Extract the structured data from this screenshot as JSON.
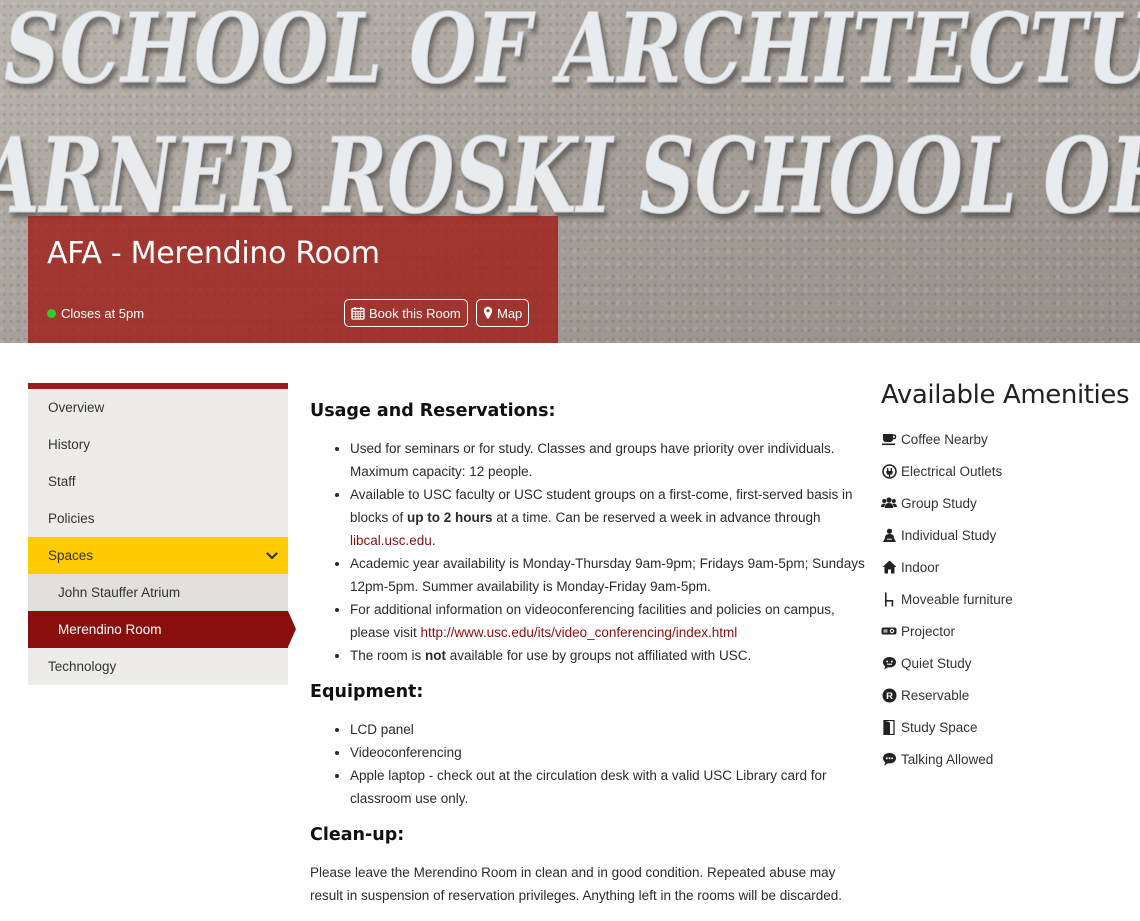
{
  "hero": {
    "engraving_line1": "SCHOOL OF ARCHITECTU",
    "engraving_line2": "ARNER ROSKI SCHOOL OF",
    "title": "AFA - Merendino Room",
    "status": "Closes at 5pm",
    "status_color": "#2ecc2e",
    "book_label": "Book this Room",
    "map_label": "Map",
    "card_color": "#a01e1a"
  },
  "sidebar": {
    "items": [
      {
        "label": "Overview"
      },
      {
        "label": "History"
      },
      {
        "label": "Staff"
      },
      {
        "label": "Policies"
      },
      {
        "label": "Spaces"
      },
      {
        "label": "John Stauffer Atrium"
      },
      {
        "label": "Merendino Room"
      },
      {
        "label": "Technology"
      }
    ]
  },
  "main": {
    "usage_heading": "Usage and Reservations:",
    "usage": {
      "item1": "Used for seminars or for study. Classes and groups have priority over individuals. Maximum capacity: 12 people.",
      "item2_pre": "Available to USC faculty or USC student groups on a first-come, first-served basis in blocks of ",
      "item2_bold": "up to 2 hours",
      "item2_mid": " at a time. Can be reserved a week in advance through ",
      "item2_link": "libcal.usc.edu",
      "item2_post": ".",
      "item3": "Academic year availability is Monday-Thursday 9am-9pm; Fridays 9am-5pm; Sundays 12pm-5pm. Summer availability is Monday-Friday 9am-5pm.",
      "item4_pre": "For additional information on videoconferencing facilities and policies on campus, please visit ",
      "item4_link": "http://www.usc.edu/its/video_conferencing/index.html",
      "item5_pre": "The room is ",
      "item5_bold": "not",
      "item5_post": " available for use by groups not affiliated with USC."
    },
    "equipment_heading": "Equipment:",
    "equipment": [
      "LCD panel",
      "Videoconferencing",
      "Apple laptop -  check out at the circulation desk with a valid USC Library card for classroom use only."
    ],
    "cleanup_heading": "Clean-up:",
    "cleanup_text": "Please leave the Merendino Room in clean and in good condition. Repeated abuse may result in suspension of reservation privileges. Anything left in the rooms will be discarded."
  },
  "amenities": {
    "title": "Available Amenities",
    "items": [
      {
        "label": "Coffee Nearby",
        "icon": "coffee-icon"
      },
      {
        "label": "Electrical Outlets",
        "icon": "plug-icon"
      },
      {
        "label": "Group Study",
        "icon": "group-icon"
      },
      {
        "label": "Individual Study",
        "icon": "person-icon"
      },
      {
        "label": "Indoor",
        "icon": "home-icon"
      },
      {
        "label": "Moveable furniture",
        "icon": "chair-icon"
      },
      {
        "label": "Projector",
        "icon": "projector-icon"
      },
      {
        "label": "Quiet Study",
        "icon": "quiet-icon"
      },
      {
        "label": "Reservable",
        "icon": "reservable-icon"
      },
      {
        "label": "Study Space",
        "icon": "door-icon"
      },
      {
        "label": "Talking Allowed",
        "icon": "talk-icon"
      }
    ]
  }
}
